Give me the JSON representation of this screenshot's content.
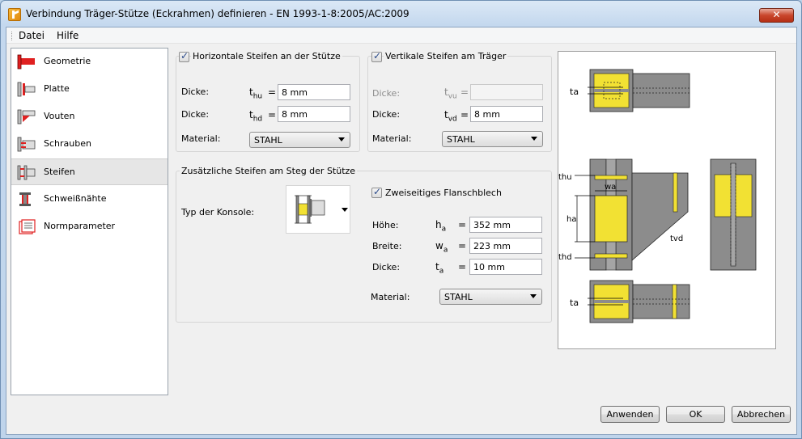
{
  "window": {
    "title": "Verbindung Träger-Stütze (Eckrahmen) definieren - EN 1993-1-8:2005/AC:2009",
    "close_label": "✕"
  },
  "menu": [
    "Datei",
    "Hilfe"
  ],
  "nav": {
    "items": [
      {
        "label": "Geometrie",
        "icon": "geometry-icon"
      },
      {
        "label": "Platte",
        "icon": "plate-icon"
      },
      {
        "label": "Vouten",
        "icon": "haunch-icon"
      },
      {
        "label": "Schrauben",
        "icon": "bolts-icon"
      },
      {
        "label": "Steifen",
        "icon": "stiffeners-icon",
        "selected": true
      },
      {
        "label": "Schweißnähte",
        "icon": "welds-icon"
      },
      {
        "label": "Normparameter",
        "icon": "code-parameters-icon"
      }
    ]
  },
  "horizontal": {
    "title": "Horizontale Steifen an der Stütze",
    "checked": true,
    "thickness_label": "Dicke:",
    "thu_sym": "t",
    "thu_sub": "hu",
    "thu_value": "8 mm",
    "thd_sym": "t",
    "thd_sub": "hd",
    "thd_value": "8 mm",
    "eq": "=",
    "material_label": "Material:",
    "material": "STAHL"
  },
  "vertical": {
    "title": "Vertikale Steifen am Träger",
    "checked": true,
    "thickness_label": "Dicke:",
    "tvu_sym": "t",
    "tvu_sub": "vu",
    "tvu_value": "",
    "tvd_sym": "t",
    "tvd_sub": "vd",
    "tvd_value": "8 mm",
    "eq": "=",
    "material_label": "Material:",
    "material": "STAHL"
  },
  "additional": {
    "title": "Zusätzliche Steifen am Steg der Stütze",
    "konsole_label": "Typ der Konsole:",
    "flange_plate_label": "Zweiseitiges Flanschblech",
    "flange_plate_checked": true,
    "height_label": "Höhe:",
    "ha_sym": "h",
    "ha_sub": "a",
    "ha_value": "352 mm",
    "width_label": "Breite:",
    "wa_sym": "w",
    "wa_sub": "a",
    "wa_value": "223 mm",
    "thickness_label": "Dicke:",
    "ta_sym": "t",
    "ta_sub": "a",
    "ta_value": "10 mm",
    "eq": "=",
    "material_label": "Material:",
    "material": "STAHL"
  },
  "preview": {
    "labels": {
      "ta_top": "ta",
      "thu": "thu",
      "wa": "wa",
      "ha": "ha",
      "thd": "thd",
      "tvd": "tvd",
      "ta_bottom": "ta"
    }
  },
  "buttons": {
    "apply": "Anwenden",
    "ok": "OK",
    "cancel": "Abbrechen"
  },
  "colors": {
    "accent_yellow": "#f2e133",
    "steel_gray": "#8c8c8c",
    "nav_red": "#e02020"
  }
}
